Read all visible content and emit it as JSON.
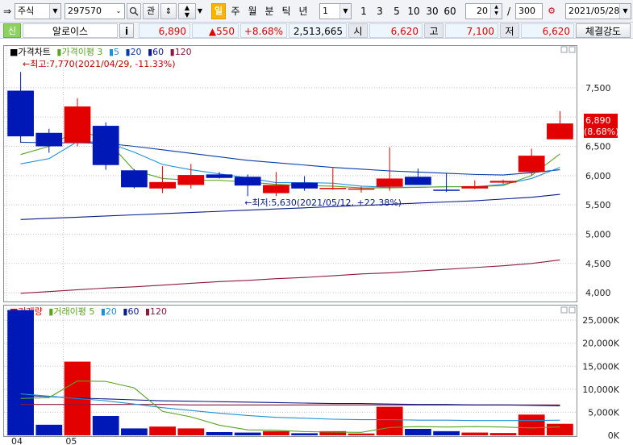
{
  "toolbar": {
    "market": "주식",
    "code": "297570",
    "btn_gwan": "관",
    "periods": [
      "주",
      "월",
      "분",
      "틱",
      "년"
    ],
    "period_selected": "일",
    "interval_value": "1",
    "intervals": [
      "1",
      "3",
      "5",
      "10",
      "30",
      "60"
    ],
    "view_count": "20",
    "slash": "/",
    "total_count": "300",
    "date": "2021/05/28"
  },
  "quote": {
    "badge": "신",
    "name": "알로이스",
    "info_button": "i",
    "price": "6,890",
    "change": "▲550",
    "change_rate": "+8.68%",
    "volume": "2,513,665",
    "open_label": "시",
    "open": "6,620",
    "high_label": "고",
    "high": "7,100",
    "low_label": "저",
    "low": "6,620",
    "strength_button": "체결강도"
  },
  "colors": {
    "up": "#e30000",
    "down": "#0019b6",
    "ma3": "#5aa321",
    "ma5": "#1e90d6",
    "ma20": "#0b3aa8",
    "ma60": "#0a1a8a",
    "ma120": "#8b1a3c"
  },
  "chart_data": [
    {
      "type": "candlestick",
      "legend": [
        {
          "label": "가격차트",
          "color": "#000000"
        },
        {
          "label": "가격이평 3",
          "color": "#5aa321"
        },
        {
          "label": "5",
          "color": "#1e90d6"
        },
        {
          "label": "20",
          "color": "#0b3aa8"
        },
        {
          "label": "60",
          "color": "#0a1a8a"
        },
        {
          "label": "120",
          "color": "#8b1a3c"
        }
      ],
      "y_ticks": [
        "7,500",
        "7,000",
        "6,500",
        "6,000",
        "5,500",
        "5,000",
        "4,500",
        "4,000"
      ],
      "ylim": [
        3850,
        8200
      ],
      "annotation_high": "←최고:7,770(2021/04/29, -11.33%)",
      "annotation_low": "←최저:5,630(2021/05/12, +22.38%)",
      "last_price_label": "6,890",
      "last_rate_label": "(8.68%)",
      "candles": [
        {
          "o": 7450,
          "h": 7770,
          "l": 6560,
          "c": 6670
        },
        {
          "o": 6730,
          "h": 6800,
          "l": 6390,
          "c": 6500
        },
        {
          "o": 6560,
          "h": 7320,
          "l": 6500,
          "c": 7180
        },
        {
          "o": 6850,
          "h": 6910,
          "l": 6100,
          "c": 6180
        },
        {
          "o": 6090,
          "h": 6110,
          "l": 5780,
          "c": 5800
        },
        {
          "o": 5780,
          "h": 6160,
          "l": 5700,
          "c": 5890
        },
        {
          "o": 5840,
          "h": 6200,
          "l": 5780,
          "c": 6010
        },
        {
          "o": 6020,
          "h": 6060,
          "l": 5950,
          "c": 5960
        },
        {
          "o": 5980,
          "h": 6020,
          "l": 5650,
          "c": 5830
        },
        {
          "o": 5700,
          "h": 6060,
          "l": 5650,
          "c": 5840
        },
        {
          "o": 5880,
          "h": 5990,
          "l": 5740,
          "c": 5780
        },
        {
          "o": 5790,
          "h": 6130,
          "l": 5760,
          "c": 5790
        },
        {
          "o": 5780,
          "h": 5810,
          "l": 5710,
          "c": 5780
        },
        {
          "o": 5810,
          "h": 6480,
          "l": 5740,
          "c": 5950
        },
        {
          "o": 5980,
          "h": 6120,
          "l": 5860,
          "c": 5840
        },
        {
          "o": 5760,
          "h": 6040,
          "l": 5720,
          "c": 5740
        },
        {
          "o": 5780,
          "h": 5920,
          "l": 5770,
          "c": 5820
        },
        {
          "o": 5880,
          "h": 5930,
          "l": 5860,
          "c": 5910
        },
        {
          "o": 6060,
          "h": 6460,
          "l": 6000,
          "c": 6340
        },
        {
          "o": 6620,
          "h": 7100,
          "l": 6620,
          "c": 6890
        }
      ],
      "ma3": [
        6360,
        6500,
        6780,
        6620,
        6090,
        5950,
        5920,
        5920,
        5890,
        5850,
        5830,
        5820,
        5790,
        5790,
        5800,
        5810,
        5810,
        5830,
        6000,
        6370
      ],
      "ma5": [
        6200,
        6290,
        6580,
        6570,
        6400,
        6190,
        6100,
        6030,
        5960,
        5880,
        5880,
        5870,
        5820,
        5800,
        5800,
        5810,
        5810,
        5850,
        5950,
        6140
      ],
      "ma20": [
        6570,
        6560,
        6560,
        6550,
        6500,
        6440,
        6380,
        6320,
        6260,
        6220,
        6180,
        6140,
        6110,
        6080,
        6060,
        6040,
        6020,
        6010,
        6050,
        6100
      ],
      "ma60": [
        5250,
        5270,
        5290,
        5310,
        5330,
        5350,
        5370,
        5390,
        5410,
        5430,
        5450,
        5470,
        5490,
        5510,
        5530,
        5550,
        5570,
        5600,
        5630,
        5680
      ],
      "ma120": [
        3990,
        4020,
        4050,
        4080,
        4100,
        4130,
        4160,
        4190,
        4210,
        4240,
        4260,
        4290,
        4320,
        4340,
        4370,
        4400,
        4430,
        4460,
        4500,
        4560
      ]
    },
    {
      "type": "bar",
      "legend": [
        {
          "label": "거래량",
          "color": "#e30000"
        },
        {
          "label": "거래이평 5",
          "color": "#5aa321"
        },
        {
          "label": "20",
          "color": "#1e90d6"
        },
        {
          "label": "60",
          "color": "#0a1a8a"
        },
        {
          "label": "120",
          "color": "#8b1a3c"
        }
      ],
      "y_ticks": [
        "25,000K",
        "20,000K",
        "15,000K",
        "10,000K",
        "5,000K",
        "0K"
      ],
      "ylim": [
        0,
        28000
      ],
      "x_labels": [
        {
          "index": 0,
          "label": "04"
        },
        {
          "index": 2,
          "label": "05"
        }
      ],
      "volumes": [
        27200,
        2300,
        16000,
        4200,
        1500,
        1900,
        1500,
        700,
        600,
        900,
        450,
        900,
        400,
        6200,
        1400,
        900,
        600,
        500,
        4500,
        2500
      ],
      "vma5": [
        8000,
        8200,
        11800,
        11700,
        10300,
        5200,
        4000,
        2200,
        1200,
        1100,
        800,
        700,
        650,
        1700,
        1900,
        1800,
        1900,
        1800,
        1600,
        1800
      ],
      "vma20": [
        9000,
        8500,
        8000,
        7500,
        6800,
        6000,
        5400,
        4800,
        4300,
        3900,
        3700,
        3500,
        3400,
        3400,
        3300,
        3300,
        3200,
        3200,
        3200,
        3300
      ],
      "vma60": [
        8700,
        8400,
        8100,
        7900,
        7700,
        7500,
        7400,
        7300,
        7200,
        7100,
        7000,
        6900,
        6900,
        6800,
        6700,
        6700,
        6600,
        6600,
        6500,
        6400
      ],
      "vma120": [
        6700,
        6700,
        6700,
        6700,
        6700,
        6700,
        6600,
        6600,
        6600,
        6600,
        6600,
        6600,
        6600,
        6600,
        6600,
        6600,
        6600,
        6600,
        6600,
        6600
      ]
    }
  ]
}
